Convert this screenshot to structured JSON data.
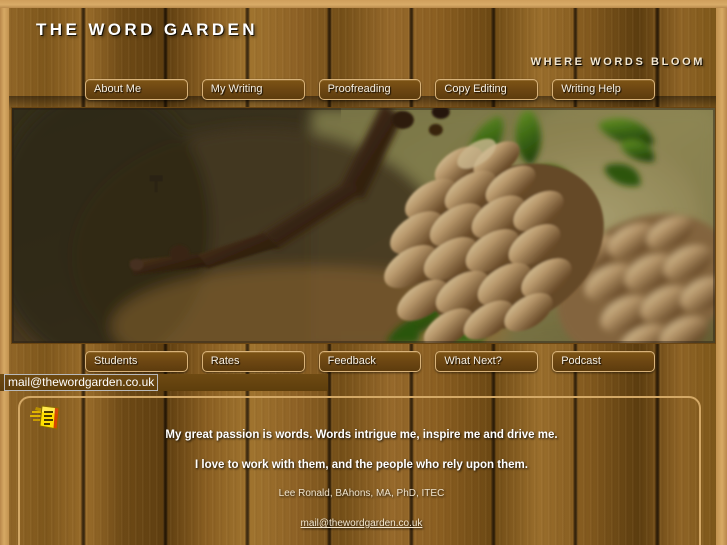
{
  "site": {
    "title": "The Word Garden",
    "tagline": "Where Words Bloom"
  },
  "nav_top": [
    {
      "label": "About Me"
    },
    {
      "label": "My Writing"
    },
    {
      "label": "Proofreading"
    },
    {
      "label": "Copy Editing"
    },
    {
      "label": "Writing Help"
    }
  ],
  "nav_bottom": [
    {
      "label": "Students"
    },
    {
      "label": "Rates"
    },
    {
      "label": "Feedback"
    },
    {
      "label": "What Next?"
    },
    {
      "label": "Podcast"
    }
  ],
  "status_bar": {
    "link_text": "mail@thewordgarden.co.uk"
  },
  "hero": {
    "alt": "pine-cones-on-branch-photo"
  },
  "content": {
    "icon": "note-document-icon",
    "line1": "My great passion is words. Words intrigue me, inspire me and drive me.",
    "line2": "I love to work with them, and the people who rely upon them.",
    "signature": "Lee Ronald, BAhons, MA, PhD, ITEC",
    "email": "mail@thewordgarden.co.uk"
  },
  "colors": {
    "wood_base": "#8a5f22",
    "border_tan": "#d3a866",
    "button_bg": "#6b4512",
    "button_border": "#d8b279",
    "text_white": "#ffffff",
    "edge_tan": "#d6a964"
  }
}
